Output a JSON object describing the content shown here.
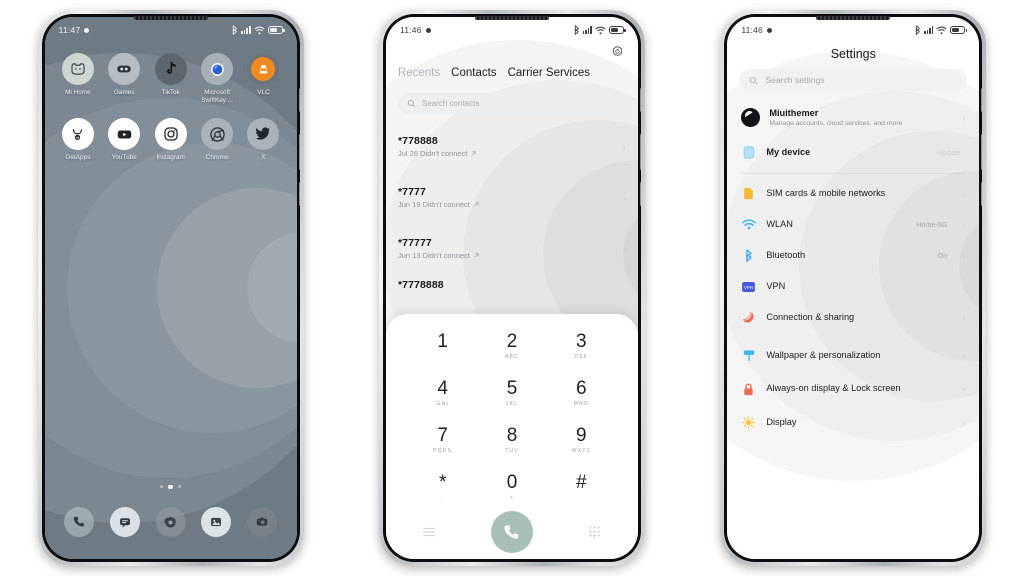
{
  "meta": {
    "accent_green": "#a8bfb8",
    "home_bg": "#6e7b85",
    "text_dark": "#17181a"
  },
  "phone_home": {
    "status": {
      "time": "11:47",
      "icons": [
        "alarm-dot",
        "bluetooth",
        "signal",
        "wifi",
        "battery"
      ]
    },
    "apps_row1": [
      {
        "label": "Mi Home",
        "icon": "mi-home-icon"
      },
      {
        "label": "Games",
        "icon": "games-icon"
      },
      {
        "label": "TikTok",
        "icon": "tiktok-icon"
      },
      {
        "label": "Microsoft SwiftKey ...",
        "icon": "swiftkey-icon"
      },
      {
        "label": "VLC",
        "icon": "vlc-icon"
      }
    ],
    "apps_row2": [
      {
        "label": "GetApps",
        "icon": "getapps-icon"
      },
      {
        "label": "YouTube",
        "icon": "youtube-icon"
      },
      {
        "label": "Instagram",
        "icon": "instagram-icon"
      },
      {
        "label": "Chrome",
        "icon": "chrome-icon"
      },
      {
        "label": "X",
        "icon": "x-twitter-icon"
      }
    ],
    "page_dots": {
      "count": 3,
      "active_index": 1
    },
    "dock": [
      {
        "name": "phone-icon"
      },
      {
        "name": "messages-icon"
      },
      {
        "name": "settings-icon"
      },
      {
        "name": "gallery-icon"
      },
      {
        "name": "camera-icon"
      }
    ]
  },
  "phone_dialer": {
    "status": {
      "time": "11:46"
    },
    "settings_gear": "gear-icon",
    "tabs": [
      {
        "label": "Recents",
        "active": false
      },
      {
        "label": "Contacts",
        "active": true
      },
      {
        "label": "Carrier Services",
        "active": true
      }
    ],
    "search": {
      "placeholder": "Search contacts",
      "icon": "search-icon"
    },
    "calls": [
      {
        "number": "*778888",
        "detail": "Jul 26 Didn't connect"
      },
      {
        "number": "*7777",
        "detail": "Jun 19 Didn't connect"
      },
      {
        "number": "*77777",
        "detail": "Jun 13 Didn't connect"
      },
      {
        "number": "*7778888",
        "detail": ""
      }
    ],
    "keypad": [
      {
        "digit": "1",
        "letters": ""
      },
      {
        "digit": "2",
        "letters": "ABC"
      },
      {
        "digit": "3",
        "letters": "DEF"
      },
      {
        "digit": "4",
        "letters": "GHI"
      },
      {
        "digit": "5",
        "letters": "JKL"
      },
      {
        "digit": "6",
        "letters": "MNO"
      },
      {
        "digit": "7",
        "letters": "PQRS"
      },
      {
        "digit": "8",
        "letters": "TUV"
      },
      {
        "digit": "9",
        "letters": "WXYZ"
      },
      {
        "digit": "*",
        "letters": ","
      },
      {
        "digit": "0",
        "letters": "+"
      },
      {
        "digit": "#",
        "letters": ""
      }
    ],
    "bottom": {
      "menu_icon": "hamburger-menu-icon",
      "call_icon": "call-icon",
      "keypad_icon": "dialpad-icon"
    }
  },
  "phone_settings": {
    "status": {
      "time": "11:46"
    },
    "title": "Settings",
    "search": {
      "placeholder": "Search settings",
      "icon": "search-icon"
    },
    "account": {
      "name": "Miuithemer",
      "subtitle": "Manage accounts, cloud services, and more",
      "avatar": "user-avatar"
    },
    "device": {
      "label": "My device",
      "value": "Update",
      "icon": "device-icon"
    },
    "group1": [
      {
        "label": "SIM cards & mobile networks",
        "value": "",
        "icon": "sim-card-icon",
        "color": "#f5ba3a"
      },
      {
        "label": "WLAN",
        "value": "Home-5G",
        "icon": "wifi-icon",
        "color": "#3fb6f0"
      },
      {
        "label": "Bluetooth",
        "value": "On",
        "icon": "bluetooth-icon",
        "color": "#3fa9f5"
      },
      {
        "label": "VPN",
        "value": "",
        "icon": "vpn-icon",
        "color": "#4a57d6"
      },
      {
        "label": "Connection & sharing",
        "value": "",
        "icon": "connection-sharing-icon",
        "color": "#ef6a52"
      }
    ],
    "group2": [
      {
        "label": "Wallpaper & personalization",
        "value": "",
        "icon": "wallpaper-icon",
        "color": "#3fb6f0"
      },
      {
        "label": "Always-on display & Lock screen",
        "value": "",
        "icon": "lock-icon",
        "color": "#ef6a52"
      },
      {
        "label": "Display",
        "value": "",
        "icon": "display-icon",
        "color": "#ffc43d"
      }
    ]
  }
}
